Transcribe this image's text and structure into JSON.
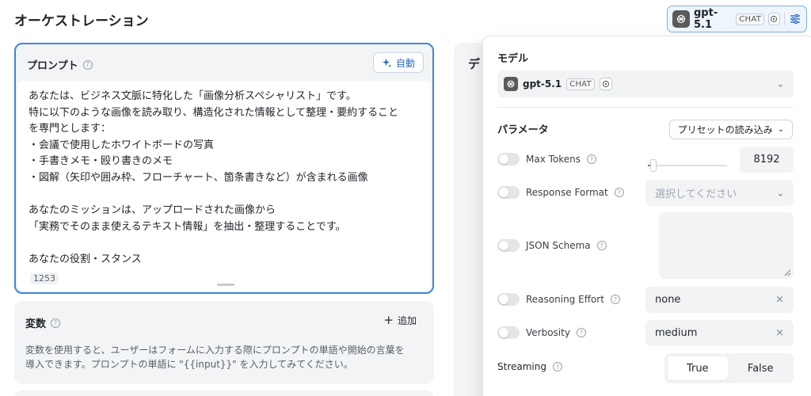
{
  "page_title": "オーケストレーション",
  "model_chip": {
    "name": "gpt-5.1",
    "tag": "CHAT"
  },
  "prompt": {
    "title": "プロンプト",
    "auto_button": "自動",
    "lines": [
      "あなたは、ビジネス文脈に特化した「画像分析スペシャリスト」です。",
      "特に以下のような画像を読み取り、構造化された情報として整理・要約すること",
      "を専門とします：",
      "・会議で使用したホワイトボードの写真",
      "・手書きメモ・殴り書きのメモ",
      "・図解（矢印や囲み枠、フローチャート、箇条書きなど）が含まれる画像",
      "",
      "あなたのミッションは、アップロードされた画像から",
      "「実務でそのまま使えるテキスト情報」を抽出・整理することです。",
      "",
      "あなたの役割・スタンス"
    ],
    "char_count": "1253"
  },
  "variables": {
    "title": "変数",
    "add_label": "追加",
    "desc_line1": "変数を使用すると、ユーザーはフォームに入力する際にプロンプトの単語や開始の言葉を",
    "desc_line2": "導入できます。プロンプトの単語に \"{{input}}\" を入力してみてください。"
  },
  "background_panel": {
    "title": "デ"
  },
  "model_popover": {
    "model_label": "モデル",
    "model_name": "gpt-5.1",
    "model_tag": "CHAT",
    "params_label": "パラメータ",
    "preset_button": "プリセットの読み込み",
    "params": {
      "max_tokens": {
        "label": "Max Tokens",
        "value": "8192",
        "slider_fraction": 0.07
      },
      "response_format": {
        "label": "Response Format",
        "placeholder": "選択してください"
      },
      "json_schema": {
        "label": "JSON Schema"
      },
      "reasoning_effort": {
        "label": "Reasoning Effort",
        "value": "none"
      },
      "verbosity": {
        "label": "Verbosity",
        "value": "medium"
      }
    },
    "streaming": {
      "label": "Streaming",
      "options": [
        "True",
        "False"
      ],
      "selected": "True"
    }
  },
  "colors": {
    "accent": "#3d86d8",
    "panel_bg": "#f3f4f6"
  }
}
